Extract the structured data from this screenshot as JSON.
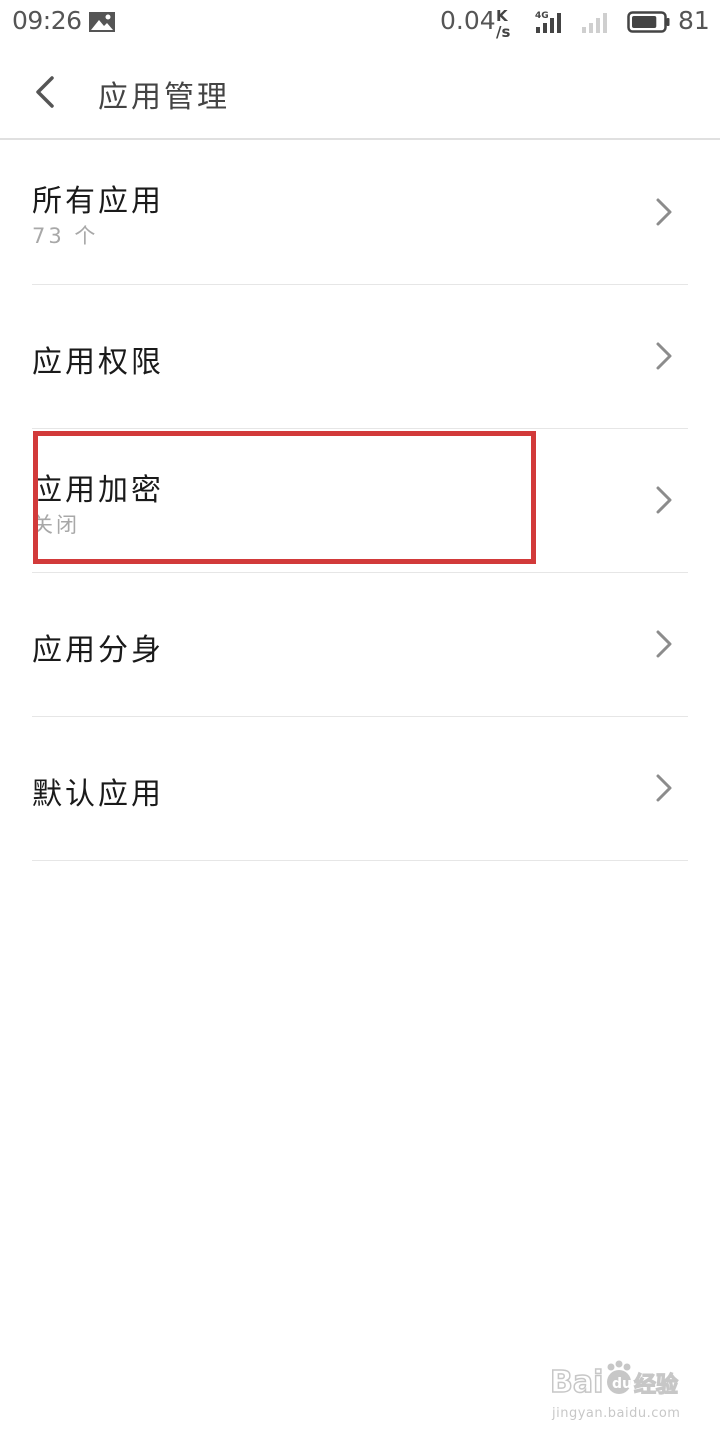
{
  "status_bar": {
    "time": "09:26",
    "net_speed": "0.04",
    "net_unit_top": "K",
    "net_unit_bottom": "/s",
    "network_type": "4G",
    "battery_percent": "81",
    "battery_level": 0.81,
    "icons": [
      "gallery-icon",
      "signal-4g-icon",
      "signal-icon",
      "battery-icon"
    ]
  },
  "header": {
    "title": "应用管理",
    "back_icon": "back-arrow-icon"
  },
  "menu": {
    "items": [
      {
        "label": "所有应用",
        "sub": "73 个"
      },
      {
        "label": "应用权限"
      },
      {
        "label": "应用加密",
        "sub": "关闭"
      },
      {
        "label": "应用分身"
      },
      {
        "label": "默认应用"
      }
    ],
    "chevron_icon": "chevron-right-icon"
  },
  "highlight": {
    "target": "应用加密",
    "color": "#d23a3a"
  },
  "watermark": {
    "logo_text": "Baidu经验",
    "url": "jingyan.baidu.com"
  },
  "colors": {
    "text_primary": "#1a1a1a",
    "text_secondary": "#a8a8a8",
    "divider": "#e6e6e6",
    "chevron": "#8c8c8c"
  }
}
